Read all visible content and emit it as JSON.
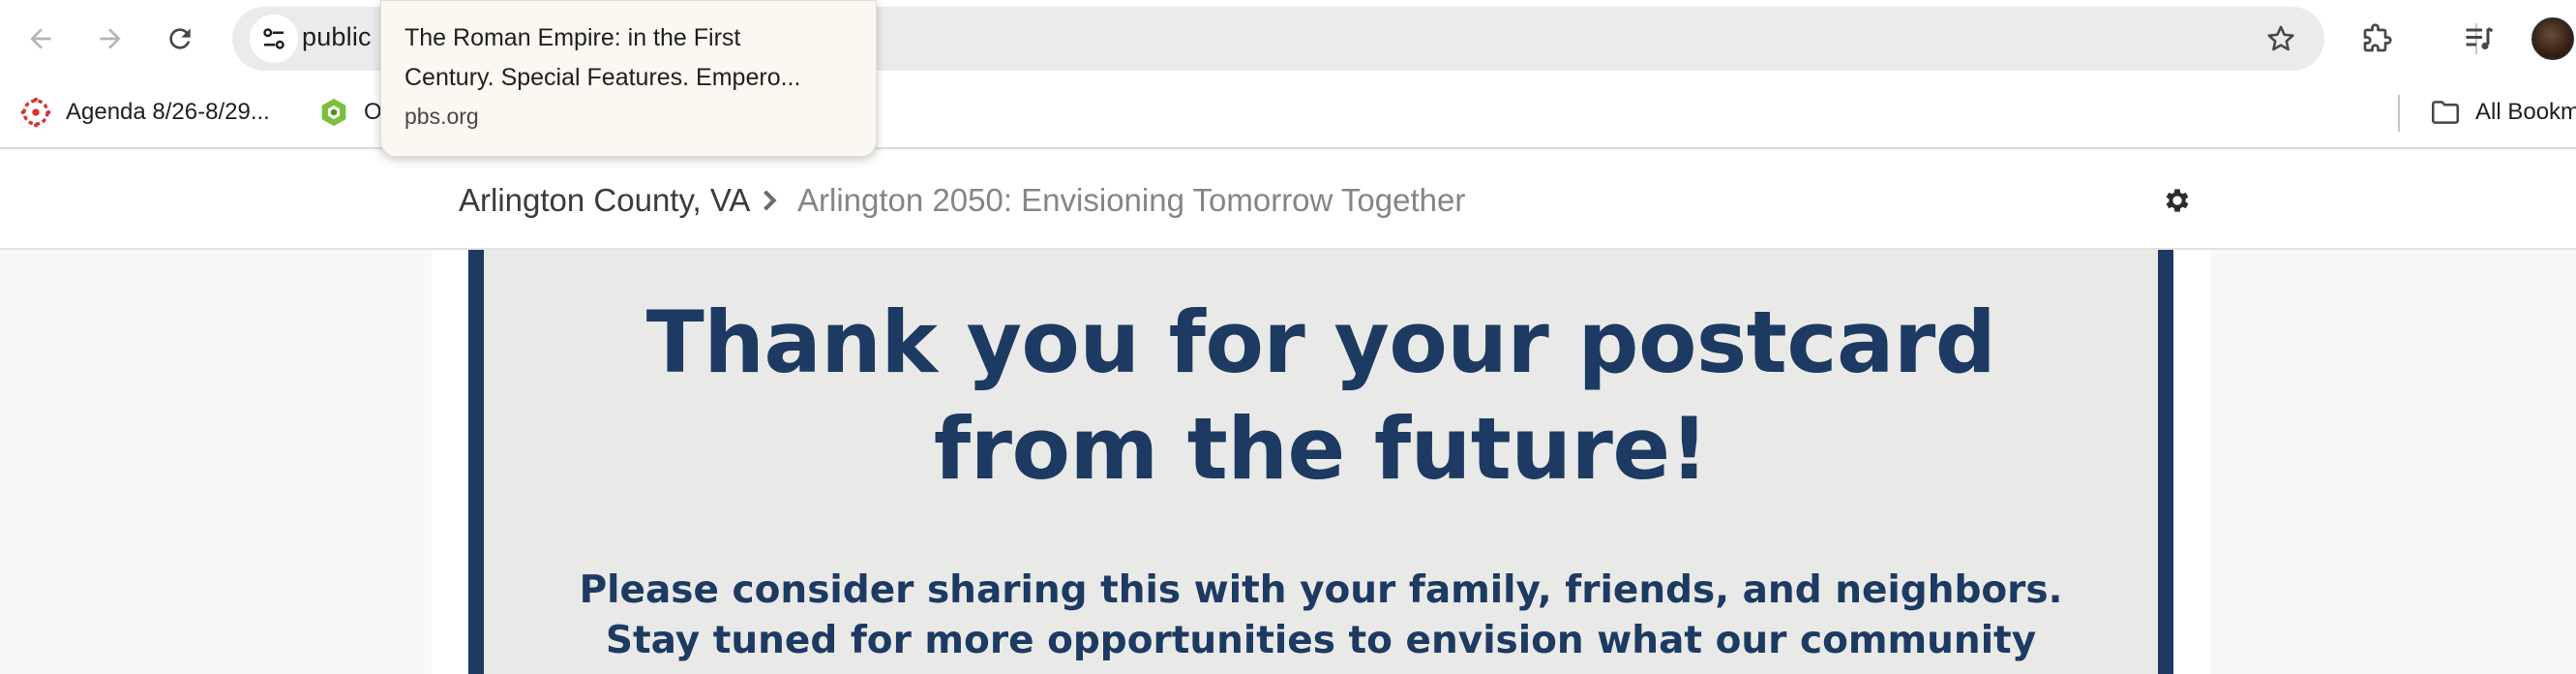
{
  "browser": {
    "address_text": "public",
    "tooltip": {
      "title_line1": "The Roman Empire: in the First",
      "title_line2": "Century. Special Features. Empero...",
      "domain": "pbs.org"
    },
    "bookmarks": [
      {
        "label": "Agenda 8/26-8/29...",
        "icon": "canvas-icon"
      },
      {
        "label": "O",
        "icon": "green-hexagon-icon"
      }
    ],
    "all_bookmarks_label": "All Bookm",
    "icons": {
      "back": "back-arrow-icon",
      "forward": "forward-arrow-icon",
      "reload": "reload-icon",
      "site_info": "tune-icon",
      "bookmark_star": "star-icon",
      "extensions": "puzzle-icon",
      "media": "media-control-icon",
      "folder": "folder-icon",
      "profile": "avatar"
    }
  },
  "page": {
    "breadcrumb": {
      "home": "Arlington County, VA",
      "current": "Arlington 2050: Envisioning Tomorrow Together"
    },
    "settings_icon": "gear-icon",
    "postcard": {
      "headline_line1": "Thank you for your postcard",
      "headline_line2": "from the future!",
      "sub_line1": "Please consider sharing this with your family, friends, and neighbors.",
      "sub_line2": "Stay tuned for more opportunities to envision what our community",
      "sub_line3": ""
    }
  },
  "colors": {
    "postcard_blue": "#1c3a62",
    "postcard_bg": "#e9e9e7",
    "omnibox_bg": "#ebebeb"
  }
}
